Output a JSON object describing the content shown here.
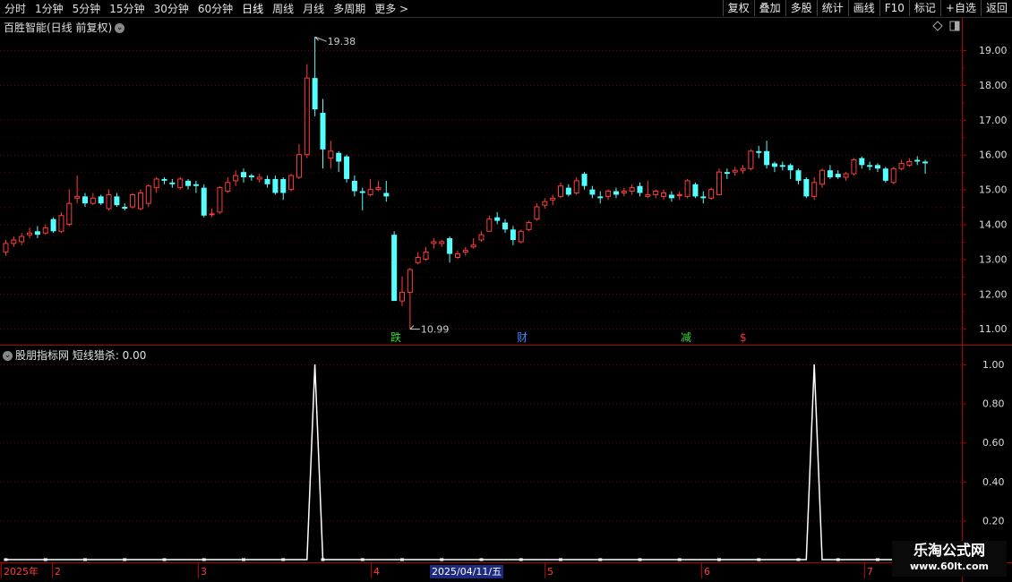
{
  "toolbar": {
    "tabs": [
      "分时",
      "1分钟",
      "5分钟",
      "15分钟",
      "30分钟",
      "60分钟",
      "日线",
      "周线",
      "月线",
      "多周期",
      "更多 >"
    ],
    "active_tab": "日线",
    "right_buttons": [
      "复权",
      "叠加",
      "多股",
      "统计",
      "画线",
      "F10",
      "标记",
      "+自选",
      "返回"
    ]
  },
  "main_chart": {
    "title": "百胜智能(日线 前复权)",
    "high_label": "19.38",
    "low_label": "10.99",
    "y_ticks": [
      "19.00",
      "18.00",
      "17.00",
      "16.00",
      "15.00",
      "14.00",
      "13.00",
      "12.00",
      "11.00"
    ],
    "events": [
      {
        "text": "跌",
        "color": "#33dd33"
      },
      {
        "text": "财",
        "color": "#4488ff"
      },
      {
        "text": "减",
        "color": "#33dd33"
      },
      {
        "text": "$",
        "color": "#ff3333"
      }
    ]
  },
  "indicator": {
    "title": "股朋指标网 短线猎杀: 0.00",
    "y_ticks": [
      "1.00",
      "0.80",
      "0.60",
      "0.40",
      "0.20"
    ]
  },
  "date_axis": {
    "labels": [
      "2025年",
      "2",
      "3",
      "4",
      "5",
      "6",
      "7"
    ],
    "cursor_date": "2025/04/11/五"
  },
  "watermark": {
    "line1": "乐淘公式网",
    "line2": "www.60lt.com"
  },
  "colors": {
    "up": "#ff3c3c",
    "down": "#54ffff",
    "grid": "#7a0000",
    "axis": "#b00000",
    "signal": "#ffffff"
  },
  "chart_data": [
    {
      "type": "candlestick",
      "title": "百胜智能(日线 前复权)",
      "ylim": [
        10.8,
        20.0
      ],
      "y_ticks": [
        11,
        12,
        13,
        14,
        15,
        16,
        17,
        18,
        19
      ],
      "candles": [
        [
          13.2,
          13.45,
          13.55,
          13.1
        ],
        [
          13.45,
          13.55,
          13.65,
          13.35
        ],
        [
          13.5,
          13.65,
          13.75,
          13.4
        ],
        [
          13.7,
          13.75,
          13.9,
          13.6
        ],
        [
          13.8,
          13.7,
          13.95,
          13.6
        ],
        [
          13.75,
          13.9,
          14.0,
          13.7
        ],
        [
          14.15,
          13.8,
          14.2,
          13.75
        ],
        [
          13.8,
          14.25,
          14.35,
          13.75
        ],
        [
          14.0,
          14.6,
          15.0,
          13.95
        ],
        [
          14.75,
          14.8,
          15.4,
          14.6
        ],
        [
          14.8,
          14.6,
          14.9,
          14.5
        ],
        [
          14.6,
          14.75,
          14.9,
          14.55
        ],
        [
          14.8,
          14.6,
          14.85,
          14.55
        ],
        [
          14.45,
          14.85,
          15.0,
          14.4
        ],
        [
          14.8,
          14.55,
          14.9,
          14.5
        ],
        [
          14.5,
          14.45,
          14.6,
          14.4
        ],
        [
          14.5,
          14.85,
          14.9,
          14.45
        ],
        [
          14.45,
          14.9,
          15.0,
          14.4
        ],
        [
          14.6,
          15.1,
          15.15,
          14.5
        ],
        [
          15.05,
          15.3,
          15.35,
          14.9
        ],
        [
          15.3,
          15.25,
          15.35,
          15.15
        ],
        [
          15.2,
          15.15,
          15.3,
          15.05
        ],
        [
          15.05,
          15.3,
          15.35,
          15.0
        ],
        [
          15.25,
          15.1,
          15.3,
          15.0
        ],
        [
          15.15,
          15.1,
          15.25,
          14.9
        ],
        [
          15.05,
          14.25,
          15.15,
          14.2
        ],
        [
          14.3,
          14.3,
          14.45,
          14.2
        ],
        [
          14.35,
          15.05,
          15.1,
          14.3
        ],
        [
          14.95,
          15.2,
          15.35,
          14.9
        ],
        [
          15.25,
          15.4,
          15.55,
          15.1
        ],
        [
          15.5,
          15.35,
          15.6,
          15.2
        ],
        [
          15.4,
          15.35,
          15.45,
          15.25
        ],
        [
          15.3,
          15.35,
          15.45,
          15.2
        ],
        [
          15.3,
          15.15,
          15.4,
          15.05
        ],
        [
          15.3,
          14.9,
          15.4,
          14.85
        ],
        [
          15.3,
          14.9,
          15.35,
          14.7
        ],
        [
          15.0,
          15.4,
          15.45,
          14.95
        ],
        [
          15.35,
          16.0,
          16.3,
          15.3
        ],
        [
          16.0,
          18.2,
          18.6,
          15.9
        ],
        [
          18.2,
          17.3,
          19.38,
          17.1
        ],
        [
          17.2,
          16.15,
          17.6,
          15.6
        ],
        [
          15.9,
          16.1,
          16.4,
          15.6
        ],
        [
          16.05,
          15.8,
          16.1,
          15.5
        ],
        [
          15.95,
          15.3,
          16.0,
          15.2
        ],
        [
          15.25,
          14.95,
          15.4,
          14.8
        ],
        [
          14.95,
          14.9,
          15.05,
          14.4
        ],
        [
          14.85,
          15.0,
          15.3,
          14.8
        ],
        [
          15.0,
          15.05,
          15.25,
          14.95
        ],
        [
          14.9,
          14.8,
          15.25,
          14.65
        ],
        [
          13.7,
          11.8,
          13.8,
          11.8
        ],
        [
          11.8,
          12.05,
          12.5,
          11.65
        ],
        [
          12.05,
          12.7,
          12.75,
          10.99
        ],
        [
          12.9,
          13.05,
          13.2,
          12.85
        ],
        [
          13.0,
          13.2,
          13.35,
          12.95
        ],
        [
          13.45,
          13.5,
          13.6,
          13.3
        ],
        [
          13.45,
          13.5,
          13.55,
          13.35
        ],
        [
          13.6,
          13.15,
          13.65,
          12.9
        ],
        [
          13.05,
          13.15,
          13.25,
          13.0
        ],
        [
          13.2,
          13.25,
          13.35,
          13.1
        ],
        [
          13.35,
          13.4,
          13.6,
          13.3
        ],
        [
          13.55,
          13.7,
          13.8,
          13.5
        ],
        [
          13.8,
          14.15,
          14.25,
          13.8
        ],
        [
          14.2,
          14.1,
          14.35,
          14.0
        ],
        [
          14.05,
          13.85,
          14.15,
          13.75
        ],
        [
          13.85,
          13.55,
          13.95,
          13.4
        ],
        [
          13.5,
          13.8,
          13.85,
          13.45
        ],
        [
          13.85,
          14.05,
          14.1,
          13.8
        ],
        [
          14.15,
          14.5,
          14.6,
          14.1
        ],
        [
          14.55,
          14.65,
          14.75,
          14.45
        ],
        [
          14.7,
          14.75,
          14.85,
          14.55
        ],
        [
          14.8,
          15.1,
          15.2,
          14.75
        ],
        [
          15.05,
          14.85,
          15.15,
          14.8
        ],
        [
          14.9,
          15.25,
          15.35,
          14.85
        ],
        [
          15.45,
          15.1,
          15.5,
          15.0
        ],
        [
          15.0,
          14.85,
          15.1,
          14.75
        ],
        [
          14.8,
          14.75,
          14.95,
          14.6
        ],
        [
          14.8,
          14.95,
          15.0,
          14.7
        ],
        [
          14.95,
          14.85,
          15.05,
          14.75
        ],
        [
          14.9,
          14.95,
          15.05,
          14.8
        ],
        [
          14.95,
          15.05,
          15.15,
          14.85
        ],
        [
          15.1,
          14.9,
          15.2,
          14.8
        ],
        [
          14.8,
          14.85,
          15.25,
          14.75
        ],
        [
          14.85,
          14.95,
          15.0,
          14.75
        ],
        [
          14.8,
          14.9,
          15.0,
          14.7
        ],
        [
          14.85,
          14.75,
          14.95,
          14.65
        ],
        [
          14.85,
          14.85,
          14.95,
          14.7
        ],
        [
          14.8,
          15.25,
          15.3,
          14.75
        ],
        [
          15.15,
          14.8,
          15.2,
          14.75
        ],
        [
          14.8,
          14.75,
          14.95,
          14.6
        ],
        [
          14.75,
          15.0,
          15.05,
          14.7
        ],
        [
          14.85,
          15.5,
          15.6,
          14.85
        ],
        [
          15.5,
          15.45,
          15.6,
          15.3
        ],
        [
          15.5,
          15.55,
          15.65,
          15.4
        ],
        [
          15.55,
          15.6,
          15.7,
          15.45
        ],
        [
          15.6,
          16.1,
          16.15,
          15.55
        ],
        [
          16.1,
          16.05,
          16.25,
          15.9
        ],
        [
          16.1,
          15.7,
          16.4,
          15.6
        ],
        [
          15.75,
          15.65,
          15.8,
          15.5
        ],
        [
          15.7,
          15.65,
          15.8,
          15.55
        ],
        [
          15.7,
          15.55,
          15.75,
          15.3
        ],
        [
          15.55,
          15.25,
          15.6,
          15.15
        ],
        [
          15.3,
          14.8,
          15.35,
          14.75
        ],
        [
          14.8,
          15.2,
          15.35,
          14.7
        ],
        [
          15.15,
          15.55,
          15.6,
          15.05
        ],
        [
          15.55,
          15.35,
          15.7,
          15.3
        ],
        [
          15.45,
          15.35,
          15.55,
          15.3
        ],
        [
          15.35,
          15.45,
          15.5,
          15.25
        ],
        [
          15.45,
          15.85,
          15.9,
          15.4
        ],
        [
          15.9,
          15.7,
          15.95,
          15.6
        ],
        [
          15.7,
          15.65,
          15.8,
          15.55
        ],
        [
          15.7,
          15.6,
          15.75,
          15.5
        ],
        [
          15.6,
          15.25,
          15.65,
          15.2
        ],
        [
          15.2,
          15.6,
          15.65,
          15.15
        ],
        [
          15.6,
          15.75,
          15.85,
          15.55
        ],
        [
          15.7,
          15.8,
          15.9,
          15.65
        ],
        [
          15.85,
          15.8,
          15.95,
          15.7
        ],
        [
          15.8,
          15.75,
          15.85,
          15.45
        ]
      ]
    },
    {
      "type": "line",
      "title": "股朋指标网 短线猎杀",
      "ylim": [
        0,
        1.1
      ],
      "y_ticks": [
        0.2,
        0.4,
        0.6,
        0.8,
        1.0
      ],
      "series": [
        {
          "signal_indices": [
            39,
            102
          ],
          "base": 0,
          "peak": 1.0
        }
      ]
    }
  ]
}
